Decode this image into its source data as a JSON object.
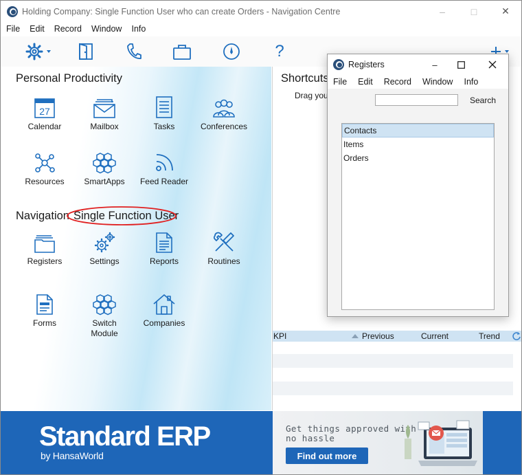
{
  "window": {
    "title": "Holding Company: Single Function User who can create Orders - Navigation Centre"
  },
  "menu": [
    "File",
    "Edit",
    "Record",
    "Window",
    "Info"
  ],
  "toolbar": {
    "icons": [
      "gear-icon",
      "door-icon",
      "phone-icon",
      "briefcase-icon",
      "compass-icon",
      "help-icon",
      "add-icon"
    ],
    "help_label": "?"
  },
  "personal": {
    "title": "Personal Productivity",
    "items": [
      {
        "label": "Calendar",
        "icon": "calendar-icon",
        "badge": "27"
      },
      {
        "label": "Mailbox",
        "icon": "mailbox-icon"
      },
      {
        "label": "Tasks",
        "icon": "tasks-icon"
      },
      {
        "label": "Conferences",
        "icon": "conferences-icon"
      },
      {
        "label": "Resources",
        "icon": "resources-icon"
      },
      {
        "label": "SmartApps",
        "icon": "smartapps-icon"
      },
      {
        "label": "Feed Reader",
        "icon": "feed-reader-icon"
      }
    ]
  },
  "navigation": {
    "title": "Navigation",
    "subtitle": "Single Function User",
    "items": [
      {
        "label": "Registers",
        "icon": "registers-icon"
      },
      {
        "label": "Settings",
        "icon": "settings-icon"
      },
      {
        "label": "Reports",
        "icon": "reports-icon"
      },
      {
        "label": "Routines",
        "icon": "routines-icon"
      },
      {
        "label": "Forms",
        "icon": "forms-icon"
      },
      {
        "label": "Switch Module",
        "icon": "switch-module-icon"
      },
      {
        "label": "Companies",
        "icon": "companies-icon"
      }
    ]
  },
  "shortcuts": {
    "title": "Shortcuts",
    "hint": "Drag your"
  },
  "kpi": {
    "columns": [
      "KPI",
      "Previous",
      "Current",
      "Trend"
    ]
  },
  "banner": {
    "brand": "Standard ERP",
    "brand_sub": "by HansaWorld",
    "promo_text": "Get things approved with no hassle",
    "promo_button": "Find out more"
  },
  "registers_window": {
    "title": "Registers",
    "menu": [
      "File",
      "Edit",
      "Record",
      "Window",
      "Info"
    ],
    "search_button": "Search",
    "search_value": "",
    "items": [
      "Contacts",
      "Items",
      "Orders"
    ],
    "selected": "Contacts"
  },
  "colors": {
    "accent": "#1e66b8",
    "icon_blue": "#1f6fbf",
    "highlight_ring": "#e02020",
    "selection": "#cfe3f3"
  }
}
